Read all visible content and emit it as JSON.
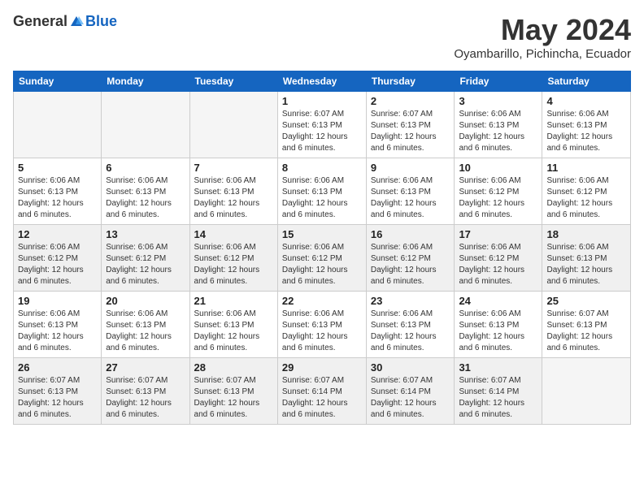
{
  "header": {
    "logo_general": "General",
    "logo_blue": "Blue",
    "month_title": "May 2024",
    "subtitle": "Oyambarillo, Pichincha, Ecuador"
  },
  "days_of_week": [
    "Sunday",
    "Monday",
    "Tuesday",
    "Wednesday",
    "Thursday",
    "Friday",
    "Saturday"
  ],
  "weeks": [
    [
      {
        "day": "",
        "info": "",
        "empty": true
      },
      {
        "day": "",
        "info": "",
        "empty": true
      },
      {
        "day": "",
        "info": "",
        "empty": true
      },
      {
        "day": "1",
        "info": "Sunrise: 6:07 AM\nSunset: 6:13 PM\nDaylight: 12 hours\nand 6 minutes."
      },
      {
        "day": "2",
        "info": "Sunrise: 6:07 AM\nSunset: 6:13 PM\nDaylight: 12 hours\nand 6 minutes."
      },
      {
        "day": "3",
        "info": "Sunrise: 6:06 AM\nSunset: 6:13 PM\nDaylight: 12 hours\nand 6 minutes."
      },
      {
        "day": "4",
        "info": "Sunrise: 6:06 AM\nSunset: 6:13 PM\nDaylight: 12 hours\nand 6 minutes."
      }
    ],
    [
      {
        "day": "5",
        "info": "Sunrise: 6:06 AM\nSunset: 6:13 PM\nDaylight: 12 hours\nand 6 minutes."
      },
      {
        "day": "6",
        "info": "Sunrise: 6:06 AM\nSunset: 6:13 PM\nDaylight: 12 hours\nand 6 minutes."
      },
      {
        "day": "7",
        "info": "Sunrise: 6:06 AM\nSunset: 6:13 PM\nDaylight: 12 hours\nand 6 minutes."
      },
      {
        "day": "8",
        "info": "Sunrise: 6:06 AM\nSunset: 6:13 PM\nDaylight: 12 hours\nand 6 minutes."
      },
      {
        "day": "9",
        "info": "Sunrise: 6:06 AM\nSunset: 6:13 PM\nDaylight: 12 hours\nand 6 minutes."
      },
      {
        "day": "10",
        "info": "Sunrise: 6:06 AM\nSunset: 6:12 PM\nDaylight: 12 hours\nand 6 minutes."
      },
      {
        "day": "11",
        "info": "Sunrise: 6:06 AM\nSunset: 6:12 PM\nDaylight: 12 hours\nand 6 minutes."
      }
    ],
    [
      {
        "day": "12",
        "info": "Sunrise: 6:06 AM\nSunset: 6:12 PM\nDaylight: 12 hours\nand 6 minutes."
      },
      {
        "day": "13",
        "info": "Sunrise: 6:06 AM\nSunset: 6:12 PM\nDaylight: 12 hours\nand 6 minutes."
      },
      {
        "day": "14",
        "info": "Sunrise: 6:06 AM\nSunset: 6:12 PM\nDaylight: 12 hours\nand 6 minutes."
      },
      {
        "day": "15",
        "info": "Sunrise: 6:06 AM\nSunset: 6:12 PM\nDaylight: 12 hours\nand 6 minutes."
      },
      {
        "day": "16",
        "info": "Sunrise: 6:06 AM\nSunset: 6:12 PM\nDaylight: 12 hours\nand 6 minutes."
      },
      {
        "day": "17",
        "info": "Sunrise: 6:06 AM\nSunset: 6:12 PM\nDaylight: 12 hours\nand 6 minutes."
      },
      {
        "day": "18",
        "info": "Sunrise: 6:06 AM\nSunset: 6:13 PM\nDaylight: 12 hours\nand 6 minutes."
      }
    ],
    [
      {
        "day": "19",
        "info": "Sunrise: 6:06 AM\nSunset: 6:13 PM\nDaylight: 12 hours\nand 6 minutes."
      },
      {
        "day": "20",
        "info": "Sunrise: 6:06 AM\nSunset: 6:13 PM\nDaylight: 12 hours\nand 6 minutes."
      },
      {
        "day": "21",
        "info": "Sunrise: 6:06 AM\nSunset: 6:13 PM\nDaylight: 12 hours\nand 6 minutes."
      },
      {
        "day": "22",
        "info": "Sunrise: 6:06 AM\nSunset: 6:13 PM\nDaylight: 12 hours\nand 6 minutes."
      },
      {
        "day": "23",
        "info": "Sunrise: 6:06 AM\nSunset: 6:13 PM\nDaylight: 12 hours\nand 6 minutes."
      },
      {
        "day": "24",
        "info": "Sunrise: 6:06 AM\nSunset: 6:13 PM\nDaylight: 12 hours\nand 6 minutes."
      },
      {
        "day": "25",
        "info": "Sunrise: 6:07 AM\nSunset: 6:13 PM\nDaylight: 12 hours\nand 6 minutes."
      }
    ],
    [
      {
        "day": "26",
        "info": "Sunrise: 6:07 AM\nSunset: 6:13 PM\nDaylight: 12 hours\nand 6 minutes."
      },
      {
        "day": "27",
        "info": "Sunrise: 6:07 AM\nSunset: 6:13 PM\nDaylight: 12 hours\nand 6 minutes."
      },
      {
        "day": "28",
        "info": "Sunrise: 6:07 AM\nSunset: 6:13 PM\nDaylight: 12 hours\nand 6 minutes."
      },
      {
        "day": "29",
        "info": "Sunrise: 6:07 AM\nSunset: 6:14 PM\nDaylight: 12 hours\nand 6 minutes."
      },
      {
        "day": "30",
        "info": "Sunrise: 6:07 AM\nSunset: 6:14 PM\nDaylight: 12 hours\nand 6 minutes."
      },
      {
        "day": "31",
        "info": "Sunrise: 6:07 AM\nSunset: 6:14 PM\nDaylight: 12 hours\nand 6 minutes."
      },
      {
        "day": "",
        "info": "",
        "empty": true
      }
    ]
  ]
}
